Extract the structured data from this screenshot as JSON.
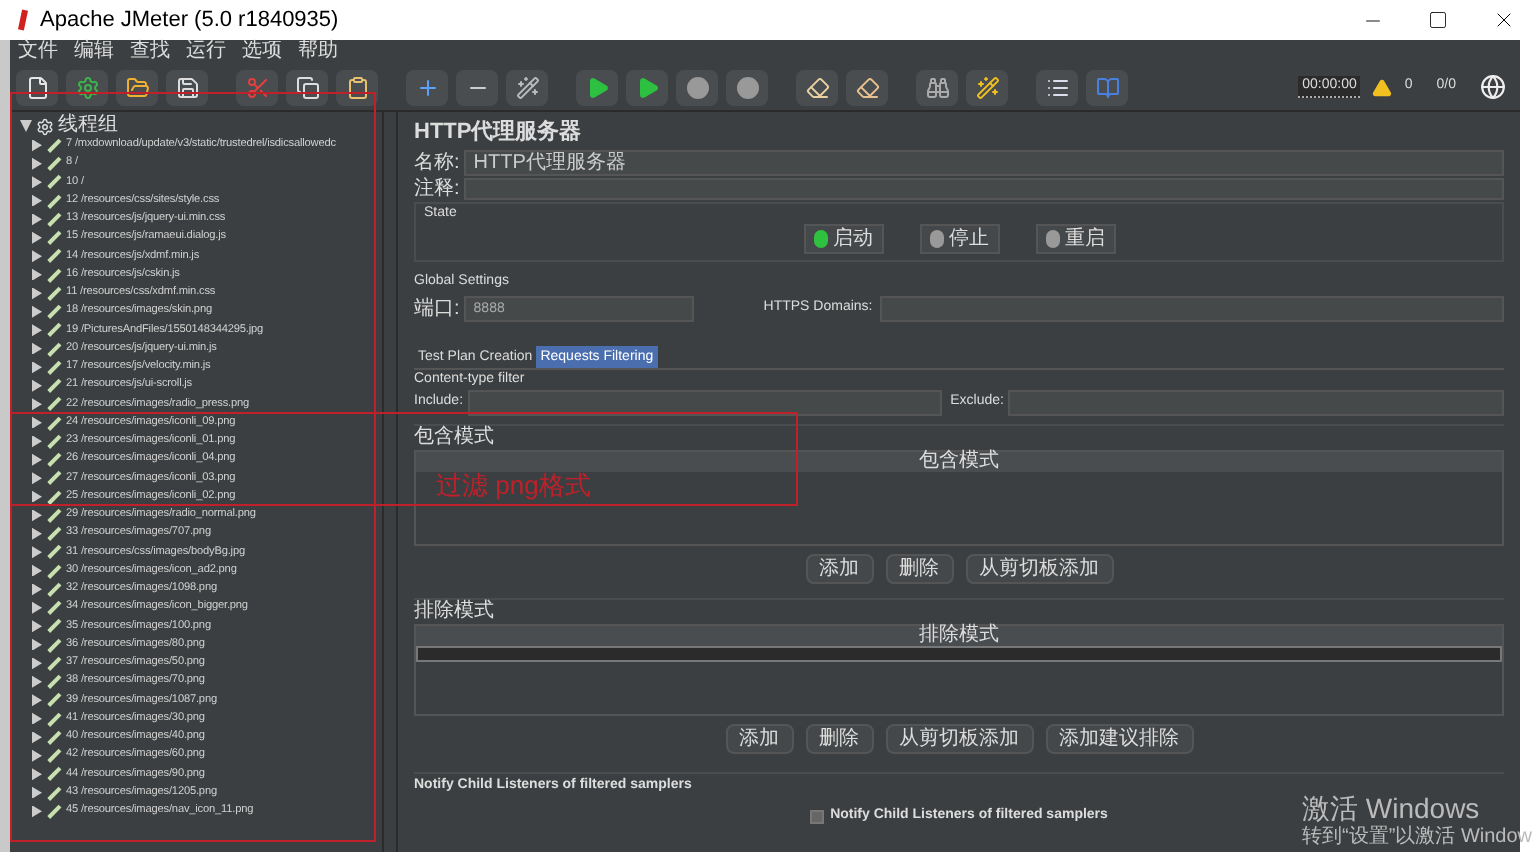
{
  "window": {
    "title": "Apache JMeter (5.0 r1840935)"
  },
  "menu": [
    "文件",
    "编辑",
    "查找",
    "运行",
    "选项",
    "帮助"
  ],
  "status": {
    "timer": "00:00:00",
    "warnings": "0",
    "threads": "0/0"
  },
  "tree": {
    "label": "线程组",
    "expanded": true,
    "children": [
      {
        "label": "7 /mxdownload/update/v3/static/trustedrel/isdicsallowedc",
        "expanded": false
      },
      {
        "label": "8 /",
        "expanded": false
      },
      {
        "label": "10 /",
        "expanded": false
      },
      {
        "label": "12 /resources/css/sites/style.css",
        "expanded": false
      },
      {
        "label": "13 /resources/js/jquery-ui.min.css",
        "expanded": false
      },
      {
        "label": "15 /resources/js/ramaeui.dialog.js",
        "expanded": false
      },
      {
        "label": "14 /resources/js/xdmf.min.js",
        "expanded": false
      },
      {
        "label": "16 /resources/js/cskin.js",
        "expanded": false
      },
      {
        "label": "11 /resources/css/xdmf.min.css",
        "expanded": false
      },
      {
        "label": "18 /resources/images/skin.png",
        "expanded": false
      },
      {
        "label": "19 /PicturesAndFiles/1550148344295.jpg",
        "expanded": false
      },
      {
        "label": "20 /resources/js/jquery-ui.min.js",
        "expanded": false
      },
      {
        "label": "17 /resources/js/velocity.min.js",
        "expanded": false
      },
      {
        "label": "21 /resources/js/ui-scroll.js",
        "expanded": false
      },
      {
        "label": "22 /resources/images/radio_press.png",
        "expanded": false
      },
      {
        "label": "24 /resources/images/iconli_09.png",
        "expanded": false
      },
      {
        "label": "23 /resources/images/iconli_01.png",
        "expanded": false
      },
      {
        "label": "26 /resources/images/iconli_04.png",
        "expanded": false
      },
      {
        "label": "27 /resources/images/iconli_03.png",
        "expanded": false
      },
      {
        "label": "25 /resources/images/iconli_02.png",
        "expanded": false
      },
      {
        "label": "29 /resources/images/radio_normal.png",
        "expanded": false
      },
      {
        "label": "33 /resources/images/707.png",
        "expanded": false
      },
      {
        "label": "31 /resources/css/images/bodyBg.jpg",
        "expanded": false
      },
      {
        "label": "30 /resources/images/icon_ad2.png",
        "expanded": false
      },
      {
        "label": "32 /resources/images/1098.png",
        "expanded": false
      },
      {
        "label": "34 /resources/images/icon_bigger.png",
        "expanded": false
      },
      {
        "label": "35 /resources/images/100.png",
        "expanded": false
      },
      {
        "label": "36 /resources/images/80.png",
        "expanded": false
      },
      {
        "label": "37 /resources/images/50.png",
        "expanded": false
      },
      {
        "label": "38 /resources/images/70.png",
        "expanded": false
      },
      {
        "label": "39 /resources/images/1087.png",
        "expanded": false
      },
      {
        "label": "41 /resources/images/30.png",
        "expanded": false
      },
      {
        "label": "40 /resources/images/40.png",
        "expanded": false
      },
      {
        "label": "42 /resources/images/60.png",
        "expanded": false
      },
      {
        "label": "44 /resources/images/90.png",
        "expanded": false
      },
      {
        "label": "43 /resources/images/1205.png",
        "expanded": false
      },
      {
        "label": "45 /resources/images/nav_icon_11.png",
        "expanded": false
      }
    ]
  },
  "panel": {
    "title": "HTTP代理服务器",
    "name_label": "名称:",
    "name_value": "HTTP代理服务器",
    "comment_label": "注释:",
    "state_title": "State",
    "state_buttons": [
      "启动",
      "停止",
      "重启"
    ],
    "global_title": "Global Settings",
    "port_label": "端口:",
    "port_value": "8888",
    "https_label": "HTTPS Domains:",
    "tabs": [
      {
        "label": "Test Plan Creation",
        "selected": false
      },
      {
        "label": "Requests Filtering",
        "selected": true
      }
    ],
    "content_filter": {
      "title": "Content-type filter",
      "include_label": "Include:",
      "exclude_label": "Exclude:"
    },
    "include_patterns": {
      "title": "包含模式",
      "column": "包含模式",
      "buttons": [
        "添加",
        "删除",
        "从剪切板添加"
      ]
    },
    "exclude_patterns": {
      "title": "排除模式",
      "column": "排除模式",
      "rows": [
        {
          "selected": true
        }
      ],
      "buttons": [
        "添加",
        "删除",
        "从剪切板添加",
        "添加建议排除"
      ]
    },
    "notify": {
      "title": "Notify Child Listeners of filtered samplers",
      "checkbox_label": "Notify Child Listeners of filtered samplers",
      "checked": false
    }
  },
  "annotation": {
    "text": "过滤 png格式"
  },
  "os_notice": {
    "title": "激活 Windows",
    "text": "转到“设置”以激活 Window"
  }
}
